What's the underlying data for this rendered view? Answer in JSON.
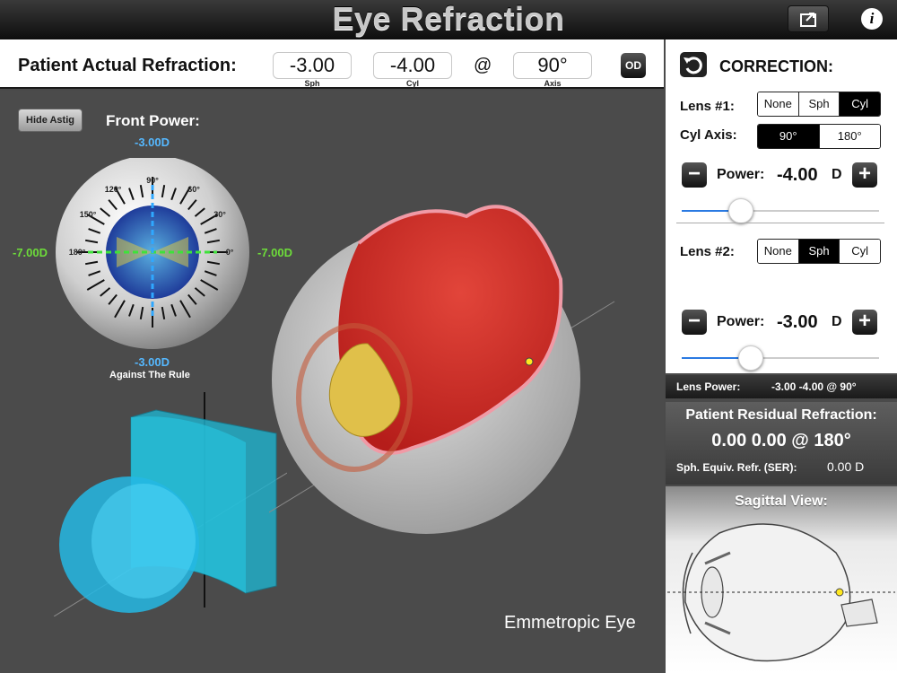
{
  "app": {
    "title": "Eye Refraction"
  },
  "header": {
    "share_icon": "share-icon",
    "info_icon": "info-icon",
    "info_glyph": "i"
  },
  "patient_refraction": {
    "label": "Patient Actual Refraction:",
    "sph": {
      "value": "-3.00",
      "sublabel": "Sph"
    },
    "cyl": {
      "value": "-4.00",
      "sublabel": "Cyl"
    },
    "at": "@",
    "axis": {
      "value": "90°",
      "sublabel": "Axis"
    },
    "eye_button": "OD"
  },
  "viewport": {
    "hide_astig_label": "Hide Astig",
    "front_power_label": "Front Power:",
    "power_top": "-3.00D",
    "power_bottom": "-3.00D",
    "power_left": "-7.00D",
    "power_right": "-7.00D",
    "rule_label": "Against The Rule",
    "eye_state_label": "Emmetropic Eye",
    "dial_angles": [
      "90°",
      "60°",
      "30°",
      "0°",
      "180°",
      "150°",
      "120°"
    ],
    "colors": {
      "vertical_meridian": "#2fa8ff",
      "horizontal_meridian": "#3ee23a",
      "lens": "#20b8d8"
    }
  },
  "correction": {
    "title": "CORRECTION:",
    "reset_icon": "undo-icon",
    "lens1": {
      "label": "Lens #1:",
      "options": [
        "None",
        "Sph",
        "Cyl"
      ],
      "selected": "Cyl",
      "cyl_axis_label": "Cyl Axis:",
      "axis_options": [
        "90°",
        "180°"
      ],
      "axis_selected": "90°",
      "power_label": "Power:",
      "power_value": "-4.00",
      "unit": "D",
      "minus": "−",
      "plus": "+",
      "slider_fraction": 0.3
    },
    "lens2": {
      "label": "Lens #2:",
      "options": [
        "None",
        "Sph",
        "Cyl"
      ],
      "selected": "Sph",
      "power_label": "Power:",
      "power_value": "-3.00",
      "unit": "D",
      "minus": "−",
      "plus": "+",
      "slider_fraction": 0.35
    }
  },
  "lens_power": {
    "label": "Lens Power:",
    "value": "-3.00 -4.00 @ 90°"
  },
  "residual": {
    "title": "Patient Residual Refraction:",
    "value": "0.00 0.00 @ 180°",
    "ser_label": "Sph. Equiv. Refr. (SER):",
    "ser_value": "0.00 D"
  },
  "sagittal": {
    "title": "Sagittal View:"
  }
}
